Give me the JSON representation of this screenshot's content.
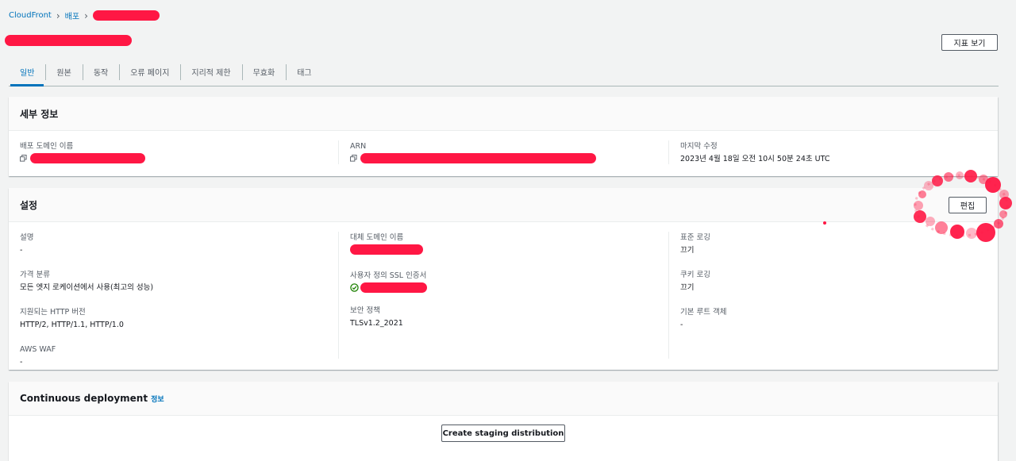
{
  "breadcrumb": {
    "root": "CloudFront",
    "second": "배포"
  },
  "header": {
    "metrics_button": "지표 보기"
  },
  "tabs": [
    {
      "label": "일반",
      "active": true
    },
    {
      "label": "원본",
      "active": false
    },
    {
      "label": "동작",
      "active": false
    },
    {
      "label": "오류 페이지",
      "active": false
    },
    {
      "label": "지리적 제한",
      "active": false
    },
    {
      "label": "무효화",
      "active": false
    },
    {
      "label": "태그",
      "active": false
    }
  ],
  "details": {
    "title": "세부 정보",
    "domain_label": "배포 도메인 이름",
    "arn_label": "ARN",
    "modified_label": "마지막 수정",
    "modified_value": "2023년 4월 18일 오전 10시 50분 24초 UTC"
  },
  "settings": {
    "title": "설정",
    "edit_button": "편집",
    "description_label": "설명",
    "description_value": "-",
    "price_label": "가격 분류",
    "price_value": "모든 엣지 로케이션에서 사용(최고의 성능)",
    "http_label": "지원되는 HTTP 버전",
    "http_value": "HTTP/2, HTTP/1.1, HTTP/1.0",
    "waf_label": "AWS WAF",
    "waf_value": "-",
    "alt_domain_label": "대체 도메인 이름",
    "ssl_label": "사용자 정의 SSL 인증서",
    "security_label": "보안 정책",
    "security_value": "TLSv1.2_2021",
    "std_logging_label": "표준 로깅",
    "std_logging_value": "끄기",
    "cookie_logging_label": "쿠키 로깅",
    "cookie_logging_value": "끄기",
    "root_object_label": "기본 루트 객체",
    "root_object_value": "-"
  },
  "continuous": {
    "title": "Continuous deployment",
    "info_link": "정보",
    "staging_button": "Create staging distribution"
  },
  "colors": {
    "link": "#0073bb",
    "redaction": "#ff1744",
    "success": "#1d8102"
  },
  "icons": [
    "chevron-right-icon",
    "copy-icon",
    "check-circle-icon"
  ]
}
